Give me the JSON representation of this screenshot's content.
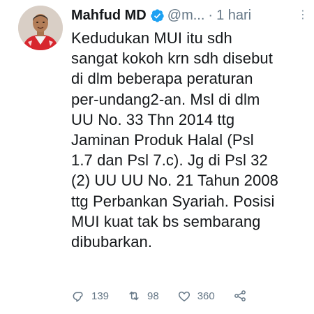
{
  "tweet": {
    "author_name": "Mahfud MD",
    "handle": "@m...",
    "separator": "·",
    "time": "1 hari",
    "more_glyph": "⋮",
    "verified_icon": "verified-badge-icon",
    "body_lines": [
      "Kedudukan MUI itu sdh",
      "sangat kokoh krn sdh disebut",
      "di dlm beberapa peraturan",
      "per-undang2-an. Msl di dlm",
      "UU No. 33 Thn 2014 ttg",
      "Jaminan Produk Halal (Psl",
      "1.7 dan Psl 7.c). Jg di Psl 32",
      "(2) UU UU No. 21 Tahun 2008",
      "ttg Perbankan Syariah. Posisi",
      "MUI kuat tak bs sembarang",
      "dibubarkan."
    ]
  },
  "actions": {
    "reply_count": "139",
    "retweet_count": "98",
    "like_count": "360",
    "icons": [
      "reply-icon",
      "retweet-icon",
      "like-icon",
      "share-icon"
    ]
  },
  "colors": {
    "verified_blue": "#1da1f2",
    "text": "#14171a",
    "muted": "#657786"
  }
}
